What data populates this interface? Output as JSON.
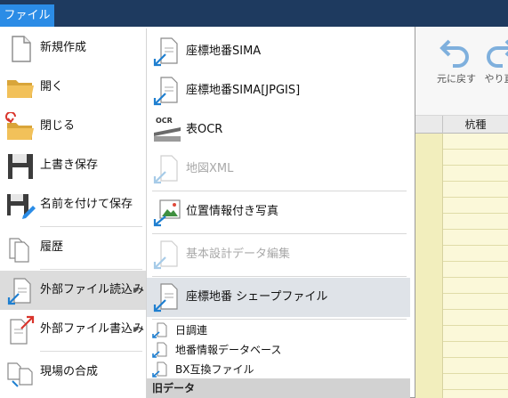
{
  "file_tab": {
    "label": "ファイル"
  },
  "ribbon": {
    "undo_label": "元に戻す",
    "redo_label": "やり直"
  },
  "grid": {
    "column_header": "杭種"
  },
  "menu": {
    "items": [
      {
        "label": "新規作成"
      },
      {
        "label": "開く"
      },
      {
        "label": "閉じる"
      },
      {
        "label": "上書き保存"
      },
      {
        "label": "名前を付けて保存"
      },
      {
        "label": "履歴"
      },
      {
        "label": "外部ファイル読込み"
      },
      {
        "label": "外部ファイル書込み"
      },
      {
        "label": "現場の合成"
      }
    ]
  },
  "submenu": {
    "items": [
      {
        "label": "座標地番SIMA",
        "enabled": true
      },
      {
        "label": "座標地番SIMA[JPGIS]",
        "enabled": true
      },
      {
        "label": "表OCR",
        "enabled": true,
        "icon_caption": "OCR"
      },
      {
        "label": "地図XML",
        "enabled": false
      },
      {
        "label": "位置情報付き写真",
        "enabled": true
      },
      {
        "label": "基本設計データ編集",
        "enabled": false
      },
      {
        "label": "座標地番 シェープファイル",
        "enabled": true
      }
    ],
    "small_items": [
      {
        "label": "日調連"
      },
      {
        "label": "地番情報データベース"
      },
      {
        "label": "BX互換ファイル"
      }
    ],
    "section_header": "旧データ"
  },
  "colors": {
    "file_tab": "#2b8ce6",
    "title_bar": "#1e3a5f",
    "import_arrow": "#1f7fd0",
    "export_arrow": "#d9342b",
    "grid_fill": "#fbf8d9"
  }
}
